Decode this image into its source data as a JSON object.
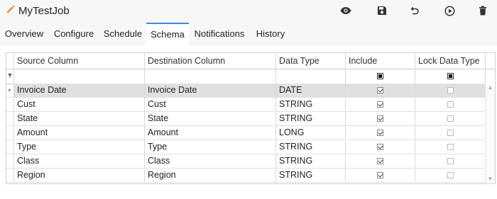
{
  "app": {
    "title": "MyTestJob",
    "title_icon": "pencil-icon",
    "accent_color": "#3b8ad8"
  },
  "toolbar": {
    "buttons": [
      {
        "name": "preview",
        "icon": "eye-icon"
      },
      {
        "name": "save",
        "icon": "save-icon"
      },
      {
        "name": "undo",
        "icon": "undo-icon"
      },
      {
        "name": "run",
        "icon": "play-circle-icon"
      },
      {
        "name": "delete",
        "icon": "trash-icon"
      }
    ]
  },
  "tabs": [
    {
      "label": "Overview",
      "active": false
    },
    {
      "label": "Configure",
      "active": false
    },
    {
      "label": "Schedule",
      "active": false
    },
    {
      "label": "Schema",
      "active": true
    },
    {
      "label": "Notifications",
      "active": false
    },
    {
      "label": "History",
      "active": false
    }
  ],
  "grid": {
    "columns": [
      "Source Column",
      "Destination Column",
      "Data Type",
      "Include",
      "Lock Data Type"
    ],
    "filter_row": {
      "include_all": "indeterminate",
      "lock_all": "indeterminate"
    },
    "rows": [
      {
        "source": "Invoice Date",
        "destination": "Invoice Date",
        "type": "DATE",
        "include": true,
        "lock": false,
        "selected": true
      },
      {
        "source": "Cust",
        "destination": "Cust",
        "type": "STRING",
        "include": true,
        "lock": false,
        "selected": false
      },
      {
        "source": "State",
        "destination": "State",
        "type": "STRING",
        "include": true,
        "lock": false,
        "selected": false
      },
      {
        "source": "Amount",
        "destination": "Amount",
        "type": "LONG",
        "include": true,
        "lock": false,
        "selected": false
      },
      {
        "source": "Type",
        "destination": "Type",
        "type": "STRING",
        "include": true,
        "lock": false,
        "selected": false
      },
      {
        "source": "Class",
        "destination": "Class",
        "type": "STRING",
        "include": true,
        "lock": false,
        "selected": false
      },
      {
        "source": "Region",
        "destination": "Region",
        "type": "STRING",
        "include": true,
        "lock": false,
        "selected": false
      }
    ]
  }
}
